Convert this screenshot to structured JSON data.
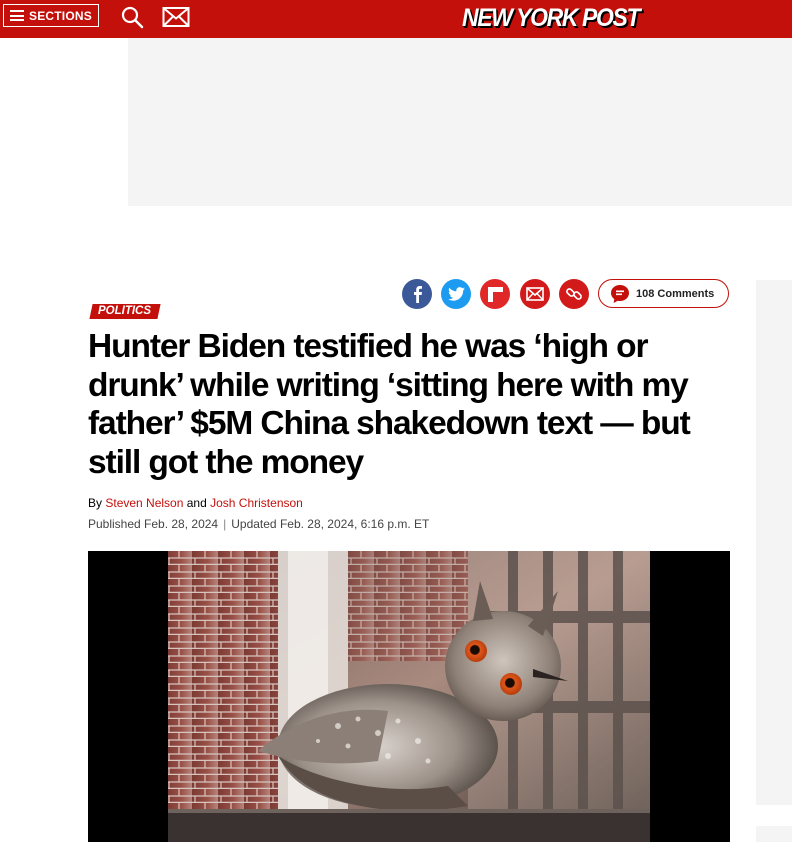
{
  "header": {
    "sections_label": "SECTIONS",
    "logo_text": "NEW YORK POST",
    "brand_color": "#c4100b"
  },
  "article": {
    "category": "POLITICS",
    "headline": "Hunter Biden testified he was ‘high or drunk’ while writing ‘sitting here with my father’ $5M China shakedown text — but still got the money",
    "byline_prefix": "By",
    "authors": [
      "Steven Nelson",
      "Josh Christenson"
    ],
    "byline_joiner": "and",
    "published": "Published Feb. 28, 2024",
    "updated": "Updated Feb. 28, 2024, 6:16 p.m. ET",
    "date_separator": "|"
  },
  "share": {
    "icons": [
      "facebook-icon",
      "twitter-icon",
      "flipboard-icon",
      "email-icon",
      "link-icon"
    ],
    "comments_label": "108 Comments"
  },
  "image": {
    "subject": "eagle owl perched on fire escape"
  }
}
